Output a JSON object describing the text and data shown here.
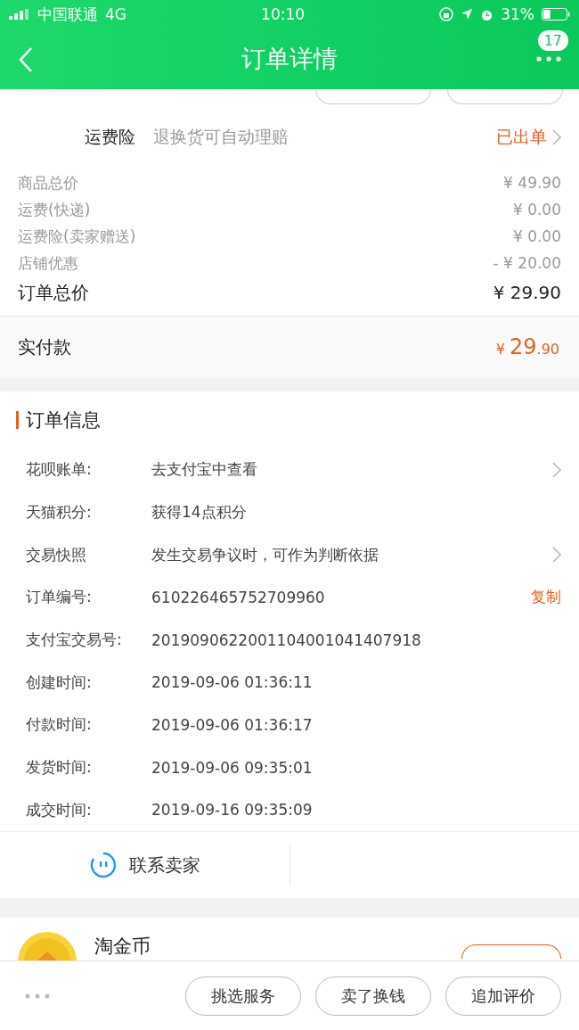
{
  "status_bar": {
    "carrier": "中国联通",
    "network": "4G",
    "time": "10:10",
    "battery": "31%"
  },
  "header": {
    "title": "订单详情",
    "badge": "17"
  },
  "insurance": {
    "label": "运费险",
    "desc": "退换货可自动理赔",
    "status": "已出单"
  },
  "price_lines": [
    {
      "label": "商品总价",
      "value": "¥ 49.90"
    },
    {
      "label": "运费(快递)",
      "value": "¥ 0.00"
    },
    {
      "label": "运费险(卖家赠送)",
      "value": "¥ 0.00"
    },
    {
      "label": "店铺优惠",
      "value": "- ¥ 20.00"
    }
  ],
  "order_total": {
    "label": "订单总价",
    "value": "¥ 29.90"
  },
  "paid": {
    "label": "实付款",
    "currency": "¥",
    "integer": "29",
    "decimal": ".90"
  },
  "order_info": {
    "title": "订单信息",
    "rows": [
      {
        "label": "花呗账单:",
        "value": "去支付宝中查看",
        "chevron": true
      },
      {
        "label": "天猫积分:",
        "value": "获得14点积分",
        "chevron": false
      },
      {
        "label": "交易快照",
        "value": "发生交易争议时，可作为判断依据",
        "chevron": true
      },
      {
        "label": "订单编号:",
        "value": "610226465752709960",
        "chevron": false,
        "link": "复制"
      },
      {
        "label": "支付宝交易号:",
        "value": "2019090622001104001041407918",
        "chevron": false
      },
      {
        "label": "创建时间:",
        "value": "2019-09-06 01:36:11",
        "chevron": false
      },
      {
        "label": "付款时间:",
        "value": "2019-09-06 01:36:17",
        "chevron": false
      },
      {
        "label": "发货时间:",
        "value": "2019-09-06 09:35:01",
        "chevron": false
      },
      {
        "label": "成交时间:",
        "value": "2019-09-16 09:35:09",
        "chevron": false
      }
    ]
  },
  "contact": {
    "label": "联系卖家"
  },
  "coin": {
    "title": "淘金币"
  },
  "bottom_buttons": [
    "挑选服务",
    "卖了换钱",
    "追加评价"
  ]
}
